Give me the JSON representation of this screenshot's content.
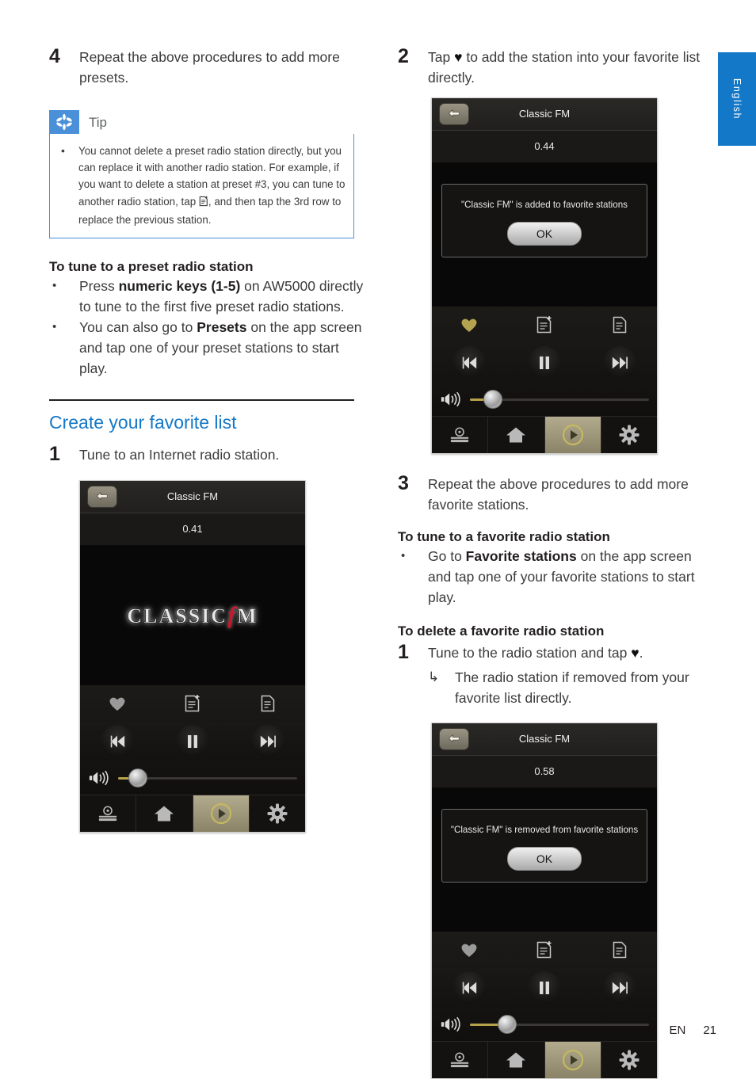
{
  "language_tab": {
    "label": "English"
  },
  "footer": {
    "lang_code": "EN",
    "page_number": "21"
  },
  "left_column": {
    "step4": {
      "number": "4",
      "text": "Repeat the above procedures to add more presets."
    },
    "tip": {
      "label": "Tip",
      "icon": "asterisk-icon",
      "bullet": "•",
      "body_part1": "You cannot delete a preset radio station directly, but you can replace it with another radio station. For example, if you want to delete a station at preset #3, you can tune to another radio station, tap ",
      "body_icon": "edit-preset-icon",
      "body_part2": ", and then tap the 3rd row to replace the previous station."
    },
    "preset_heading": "To tune to a preset radio station",
    "preset_bullets": [
      {
        "mark": "•",
        "pre": "Press ",
        "bold": "numeric keys (1-5)",
        "post": " on AW5000 directly to tune to the first five preset radio stations."
      },
      {
        "mark": "•",
        "pre": "You can also go to ",
        "bold": "Presets",
        "post": " on the app screen and tap one of your preset stations to start play."
      }
    ],
    "section_heading": "Create your favorite list",
    "step1": {
      "number": "1",
      "text": "Tune to an Internet radio station."
    },
    "device": {
      "title": "Classic FM",
      "time": "0.41",
      "logo_white": "CLASSIC",
      "logo_red": "f",
      "logo_white2": "M",
      "back_icon": "back-arrow-icon",
      "heart_state": "grey",
      "volume_percent": 10,
      "icons": {
        "favorite": "heart-icon",
        "add_preset": "add-preset-icon",
        "presets": "preset-list-icon",
        "prev": "previous-track-icon",
        "pause": "pause-icon",
        "next": "next-track-icon",
        "volume": "speaker-icon",
        "nav_device": "device-icon",
        "nav_home": "home-icon",
        "nav_play": "play-icon",
        "nav_settings": "gear-icon"
      }
    }
  },
  "right_column": {
    "step2": {
      "number": "2",
      "pre": "Tap ",
      "heart": "♥",
      "post": " to add the station into your favorite list directly."
    },
    "device_added": {
      "title": "Classic FM",
      "time": "0.44",
      "dialog_message": "\"Classic FM\" is added to favorite stations",
      "ok_label": "OK",
      "back_icon": "back-arrow-icon",
      "heart_state": "gold",
      "volume_percent": 12
    },
    "step3": {
      "number": "3",
      "text": "Repeat the above procedures to add more favorite stations."
    },
    "tune_heading": "To tune to a favorite radio station",
    "tune_bullet": {
      "mark": "•",
      "pre": "Go to ",
      "bold": "Favorite stations",
      "post": " on the app screen and tap one of your favorite stations to start play."
    },
    "delete_heading": "To delete a favorite radio station",
    "delete_step1": {
      "number": "1",
      "pre": "Tune to the radio station and tap ",
      "heart": "♥",
      "post": "."
    },
    "delete_arrow": {
      "mark": "↳",
      "text": "The radio station if removed from your favorite list directly."
    },
    "device_removed": {
      "title": "Classic FM",
      "time": "0.58",
      "dialog_message": "\"Classic FM\" is removed from favorite stations",
      "ok_label": "OK",
      "back_icon": "back-arrow-icon",
      "heart_state": "grey",
      "volume_percent": 20
    }
  },
  "colors": {
    "accent_blue": "#1478c8",
    "tip_blue": "#4a90d9",
    "gold_heart": "#b5a44f",
    "grey_heart": "#9a9a9a",
    "logo_red": "#c4182c"
  }
}
